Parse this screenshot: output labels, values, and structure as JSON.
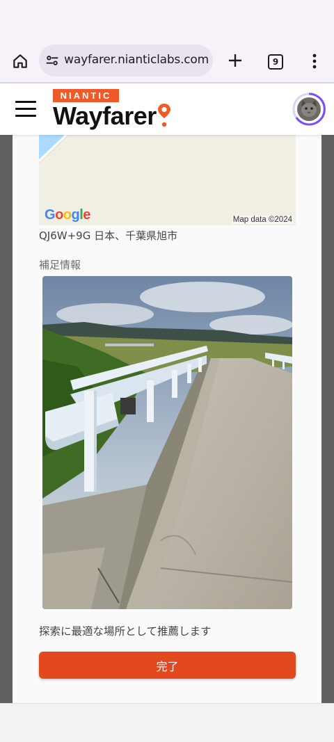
{
  "browser": {
    "url": "wayfarer.nianticlabs.com",
    "tab_count": "9"
  },
  "header": {
    "brand_badge": "NIANTIC",
    "brand_name": "Wayfarer",
    "brand_accent": "#f05a28"
  },
  "map": {
    "logo": [
      "G",
      "o",
      "o",
      "g",
      "l",
      "e"
    ],
    "credit": "Map data ©2024"
  },
  "location": {
    "address": "QJ6W+9G 日本、千葉県旭市"
  },
  "supplementary": {
    "label": "補足情報"
  },
  "recommendation": {
    "text": "探索に最適な場所として推薦します"
  },
  "actions": {
    "done_label": "完了",
    "done_color": "#e2491e"
  },
  "icons": {
    "home": "home-icon",
    "site_info": "tune-icon",
    "new_tab": "plus-icon",
    "tabs": "tab-switcher-icon",
    "overflow": "more-vert-icon",
    "menu": "hamburger-icon",
    "pin": "map-pin-icon",
    "avatar": "avatar"
  }
}
